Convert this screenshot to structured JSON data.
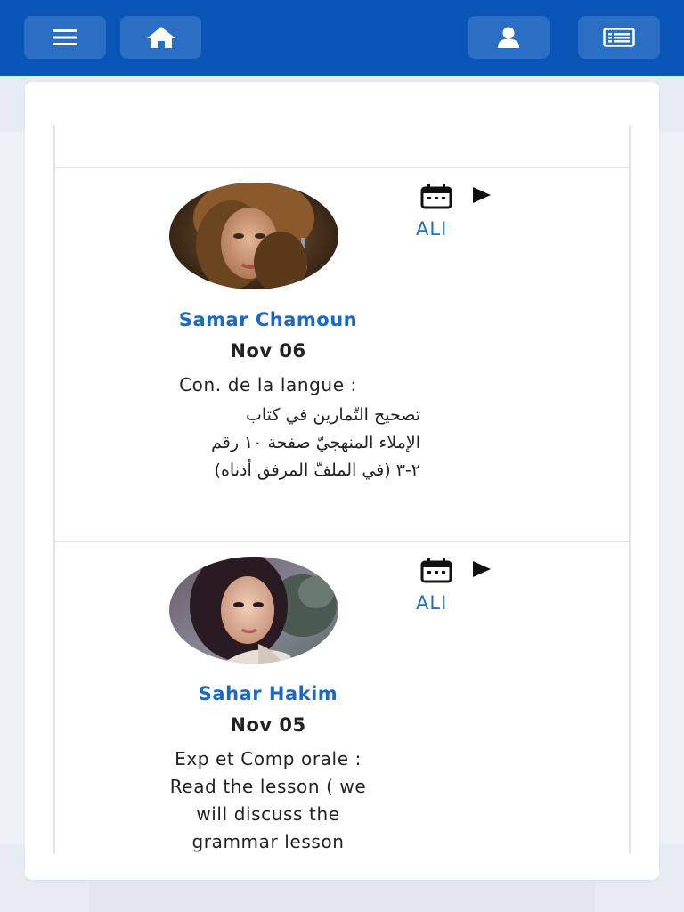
{
  "topbar": {
    "buttons": [
      {
        "name": "menu-button",
        "icon": "menu-icon"
      },
      {
        "name": "home-button",
        "icon": "home-icon"
      },
      {
        "name": "profile-button",
        "icon": "user-icon"
      },
      {
        "name": "news-button",
        "icon": "news-icon"
      }
    ],
    "colors": {
      "bar": "#0a55b8",
      "button": "#2b6fc4"
    }
  },
  "posts": [
    {
      "author": "Samar Chamoun",
      "date": "Nov 06",
      "tag": "ALI",
      "subject_line": "Con. de la langue :",
      "body_lines": [
        "تصحيح التّمارين في كتاب",
        "الإملاء المنهجيّ صفحة ١٠ رقم",
        "٢-٣ (في الملفّ المرفق أدناه)"
      ],
      "icons": [
        "calendar-icon",
        "play-icon"
      ]
    },
    {
      "author": "Sahar Hakim",
      "date": "Nov 05",
      "tag": "ALI",
      "subject_line": "Exp et Comp orale :",
      "body_lines": [
        "Read the lesson ( we",
        "will discuss the",
        "grammar lesson"
      ],
      "icons": [
        "calendar-icon",
        "play-icon"
      ]
    }
  ],
  "accent_color": "#1a68c9"
}
